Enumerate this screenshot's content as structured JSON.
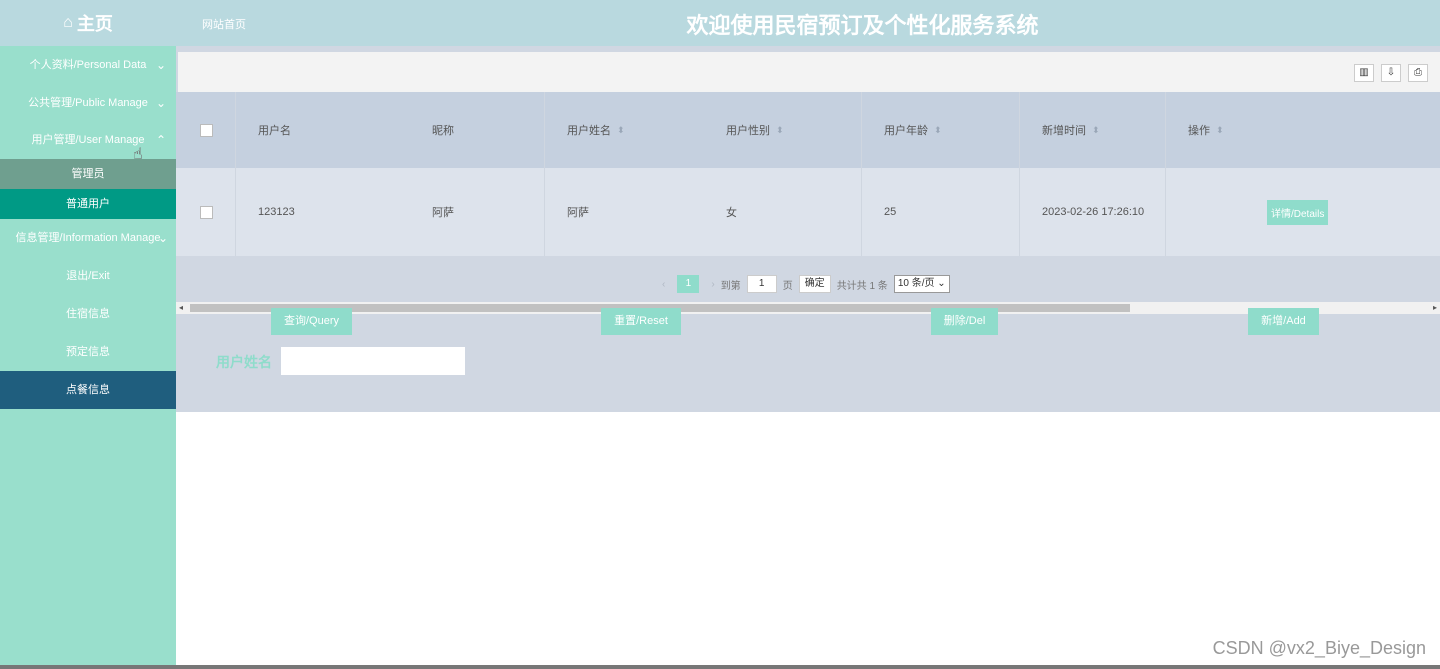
{
  "header": {
    "home_icon": "home-icon",
    "home_label": "主页",
    "site_link": "网站首页",
    "title": "欢迎使用民宿预订及个性化服务系统"
  },
  "sidebar": {
    "items": [
      {
        "label": "个人资料/Personal Data",
        "chevron": "chevron-down"
      },
      {
        "label": "公共管理/Public Manage",
        "chevron": "chevron-down"
      },
      {
        "label": "用户管理/User Manage",
        "chevron": "chevron-up",
        "expanded": true
      }
    ],
    "subitems": [
      {
        "label": "管理员"
      },
      {
        "label": "普通用户",
        "active": true
      }
    ],
    "items_after": [
      {
        "label": "信息管理/Information Manage",
        "chevron": "chevron-down"
      },
      {
        "label": "退出/Exit"
      },
      {
        "label": "住宿信息"
      },
      {
        "label": "预定信息"
      },
      {
        "label": "点餐信息",
        "highlighted": true
      }
    ]
  },
  "toolbar": {
    "icons": [
      "columns-icon",
      "export-icon",
      "print-icon"
    ]
  },
  "table": {
    "columns": [
      {
        "label": "用户名",
        "sortable": false
      },
      {
        "label": "昵称",
        "sortable": false
      },
      {
        "label": "用户姓名",
        "sortable": true
      },
      {
        "label": "用户性别",
        "sortable": true
      },
      {
        "label": "用户年龄",
        "sortable": true
      },
      {
        "label": "新增时间",
        "sortable": true
      },
      {
        "label": "操作",
        "sortable": true
      }
    ],
    "rows": [
      {
        "username": "123123",
        "nickname": "阿萨",
        "realname": "阿萨",
        "gender": "女",
        "age": "25",
        "created": "2023-02-26 17:26:10",
        "action": "详情/Details"
      }
    ]
  },
  "pagination": {
    "current_page": "1",
    "goto_prefix": "到第",
    "goto_value": "1",
    "goto_suffix": "页",
    "confirm": "确定",
    "total": "共计共 1 条",
    "page_size": "10 条/页"
  },
  "actions": {
    "query": "查询/Query",
    "reset": "重置/Reset",
    "delete": "删除/Del",
    "add": "新增/Add"
  },
  "search": {
    "label": "用户姓名",
    "value": ""
  },
  "watermark": "CSDN @vx2_Biye_Design",
  "colors": {
    "header_bg": "#b9d9df",
    "sidebar_bg": "#99dfcc",
    "accent": "#8fdccb",
    "active_sub": "#009a85",
    "highlight": "#1f5e7e"
  }
}
